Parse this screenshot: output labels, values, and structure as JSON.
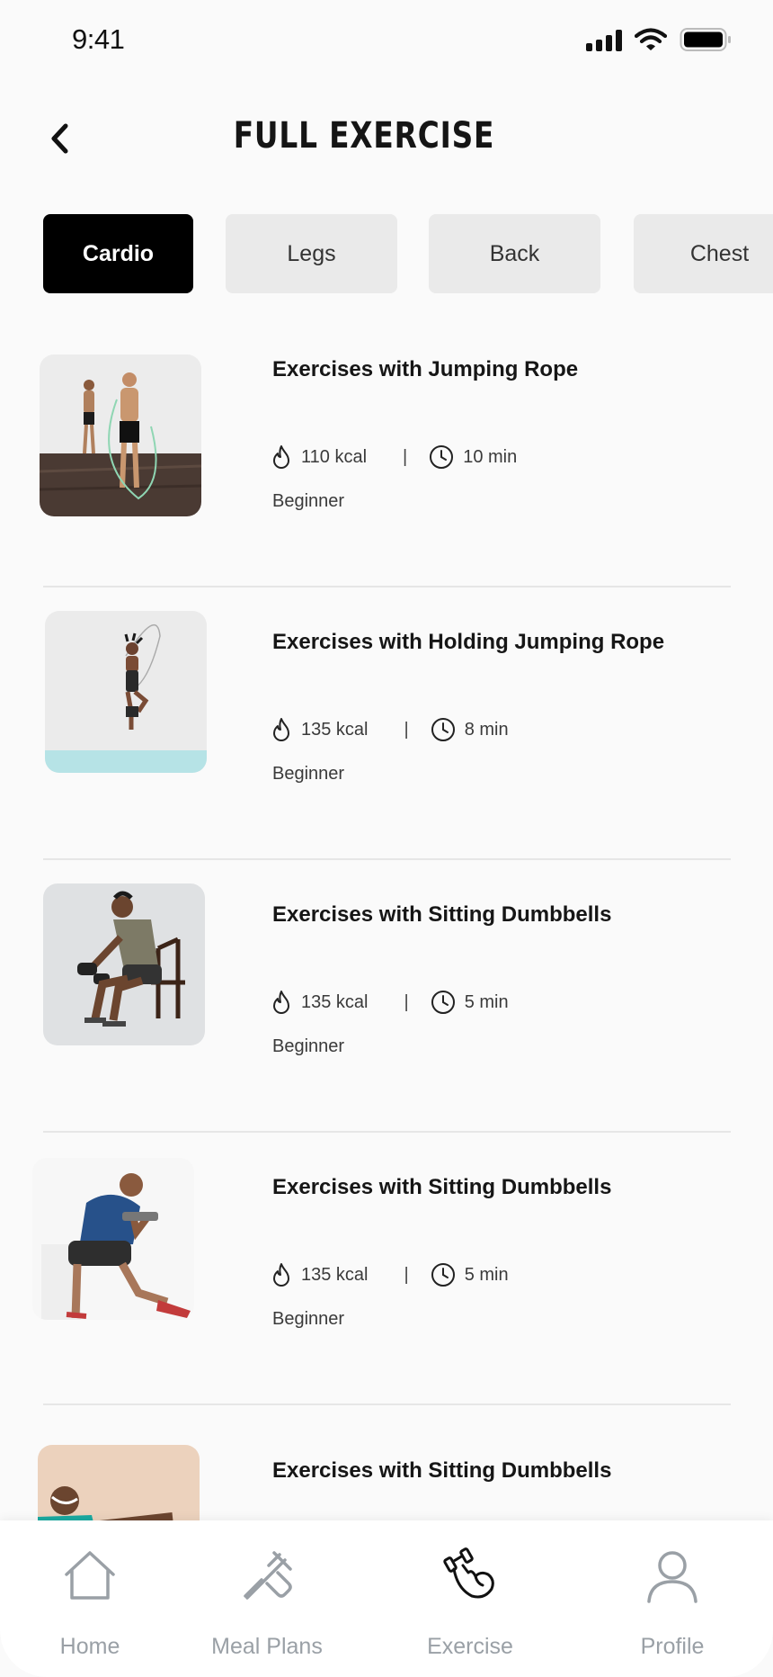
{
  "status": {
    "time": "9:41"
  },
  "header": {
    "title": "FULL EXERCISE"
  },
  "tabs": [
    {
      "label": "Cardio",
      "active": true
    },
    {
      "label": "Legs",
      "active": false
    },
    {
      "label": "Back",
      "active": false
    },
    {
      "label": "Chest",
      "active": false
    }
  ],
  "exercises": [
    {
      "title": "Exercises with Jumping Rope",
      "kcal": "110 kcal",
      "duration": "10 min",
      "level": "Beginner"
    },
    {
      "title": "Exercises with Holding Jumping Rope",
      "kcal": "135 kcal",
      "duration": "8 min",
      "level": "Beginner"
    },
    {
      "title": "Exercises with Sitting Dumbbells",
      "kcal": "135 kcal",
      "duration": "5 min",
      "level": "Beginner"
    },
    {
      "title": "Exercises with Sitting Dumbbells",
      "kcal": "135 kcal",
      "duration": "5 min",
      "level": "Beginner"
    },
    {
      "title": "Exercises with Sitting Dumbbells"
    }
  ],
  "meta_separator": "|",
  "nav": [
    {
      "label": "Home",
      "icon": "home-icon",
      "active": false
    },
    {
      "label": "Meal Plans",
      "icon": "utensils-icon",
      "active": false
    },
    {
      "label": "Exercise",
      "icon": "dumbbell-arm-icon",
      "active": true
    },
    {
      "label": "Profile",
      "icon": "profile-icon",
      "active": false
    }
  ],
  "colors": {
    "active_tab_bg": "#000000",
    "inactive_tab_bg": "#eaeaea",
    "nav_inactive": "#9aa0a6",
    "nav_active": "#111111"
  }
}
